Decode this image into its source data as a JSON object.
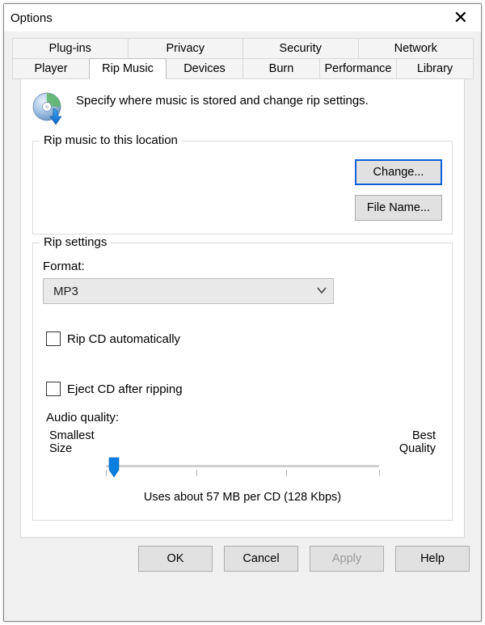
{
  "window_title": "Options",
  "close_glyph": "✕",
  "tabs_row1": [
    {
      "label": "Plug-ins"
    },
    {
      "label": "Privacy"
    },
    {
      "label": "Security"
    },
    {
      "label": "Network"
    }
  ],
  "tabs_row2": [
    {
      "label": "Player"
    },
    {
      "label": "Rip Music",
      "active": true
    },
    {
      "label": "Devices"
    },
    {
      "label": "Burn"
    },
    {
      "label": "Performance"
    },
    {
      "label": "Library"
    }
  ],
  "intro_text": "Specify where music is stored and change rip settings.",
  "location_box": {
    "legend": "Rip music to this location",
    "change_label": "Change...",
    "filename_label": "File Name..."
  },
  "settings_box": {
    "legend": "Rip settings",
    "format_label": "Format:",
    "format_value": "MP3",
    "auto_rip_label": "Rip CD automatically",
    "auto_rip_checked": false,
    "eject_label": "Eject CD after ripping",
    "eject_checked": false,
    "audio_quality_label": "Audio quality:",
    "slider_left_label1": "Smallest",
    "slider_left_label2": "Size",
    "slider_right_label1": "Best",
    "slider_right_label2": "Quality",
    "slider_info": "Uses about 57 MB per CD (128 Kbps)",
    "slider_position_pct": 3
  },
  "buttons": {
    "ok": "OK",
    "cancel": "Cancel",
    "apply": "Apply",
    "help": "Help"
  }
}
